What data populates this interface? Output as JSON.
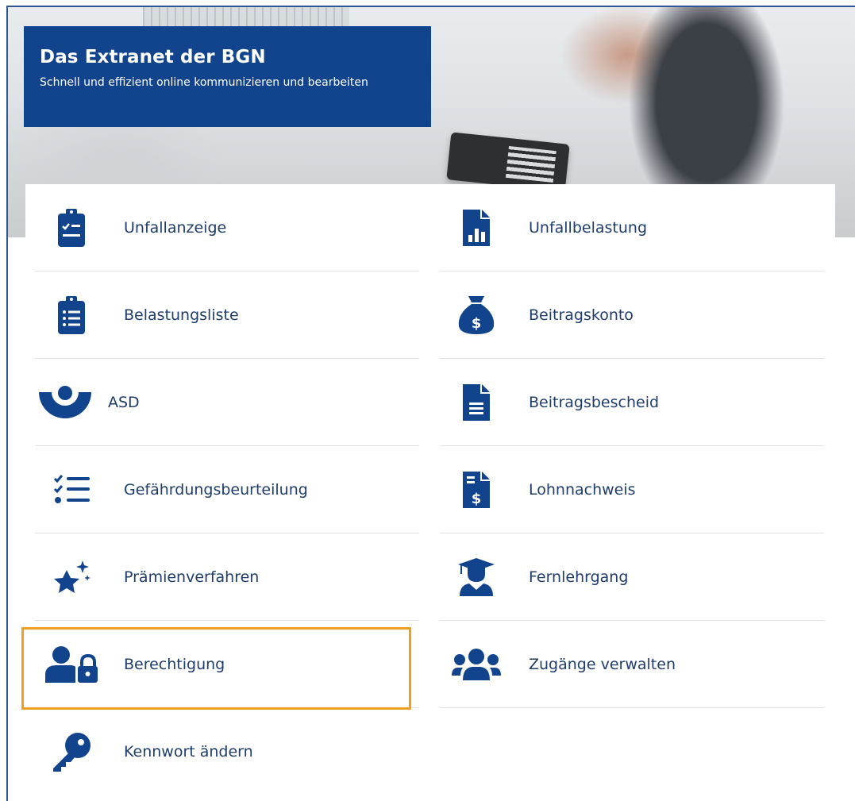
{
  "banner": {
    "title": "Das Extranet der BGN",
    "subtitle": "Schnell und effizient online kommunizieren und bearbeiten"
  },
  "brand_color": "#12448e",
  "highlight_color": "#f0a020",
  "tiles_left": [
    {
      "label": "Unfallanzeige",
      "icon": "clipboard-check-icon"
    },
    {
      "label": "Belastungsliste",
      "icon": "clipboard-list-icon"
    },
    {
      "label": "ASD",
      "icon": "asd-logo-icon"
    },
    {
      "label": "Gefährdungsbeurteilung",
      "icon": "checklist-icon"
    },
    {
      "label": "Prämienverfahren",
      "icon": "star-sparkle-icon"
    },
    {
      "label": "Berechtigung",
      "icon": "user-lock-icon"
    },
    {
      "label": "Kennwort ändern",
      "icon": "key-icon"
    }
  ],
  "tiles_right": [
    {
      "label": "Unfallbelastung",
      "icon": "file-chart-icon"
    },
    {
      "label": "Beitragskonto",
      "icon": "money-bag-icon"
    },
    {
      "label": "Beitragsbescheid",
      "icon": "file-text-icon"
    },
    {
      "label": "Lohnnachweis",
      "icon": "file-dollar-icon"
    },
    {
      "label": "Fernlehrgang",
      "icon": "graduate-icon"
    },
    {
      "label": "Zugänge verwalten",
      "icon": "users-icon"
    }
  ]
}
